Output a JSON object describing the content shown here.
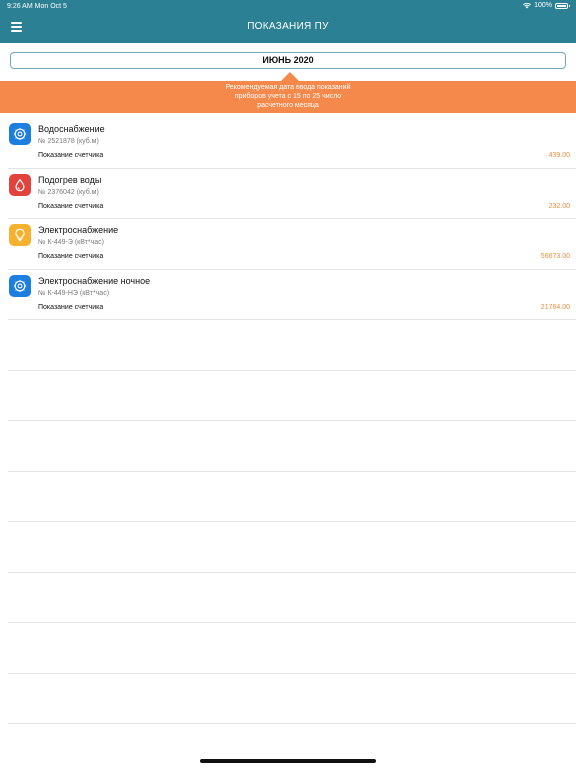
{
  "status_bar": {
    "time": "9:26 AM",
    "date": "Mon Oct 5",
    "battery": "100%"
  },
  "header": {
    "title": "ПОКАЗАНИЯ ПУ",
    "background": "#2b8193",
    "menu_icon": "hamburger-icon"
  },
  "month_selector": {
    "label": "ИЮНЬ 2020"
  },
  "notice": {
    "lines": [
      "Рекомендуемая дата ввода показаний",
      "приборов учета с 15 по 25 число",
      "расчетного месяца"
    ],
    "background": "#f5894b"
  },
  "meters": [
    {
      "name": "Водоснабжение",
      "number": "№ 2521878 (куб.м)",
      "reading_label": "Показание счетчика",
      "reading_value": "439.00",
      "icon": "water-supply-icon",
      "icon_color": "#1c7fe0"
    },
    {
      "name": "Подогрев воды",
      "number": "№ 2376042 (куб.м)",
      "reading_label": "Показание счетчика",
      "reading_value": "232.00",
      "icon": "water-drop-icon",
      "icon_color": "#e2433c"
    },
    {
      "name": "Электроснабжение",
      "number": "№ К-449-Э (кВт*час)",
      "reading_label": "Показание счетчика",
      "reading_value": "56673.00",
      "icon": "light-bulb-icon",
      "icon_color": "#f6b12f"
    },
    {
      "name": "Электроснабжение ночное",
      "number": "№ К-449-НЭ (кВт*час)",
      "reading_label": "Показание счетчика",
      "reading_value": "21764.00",
      "icon": "night-electricity-icon",
      "icon_color": "#1c7fe0"
    }
  ],
  "accent_color": "#f08a3c"
}
